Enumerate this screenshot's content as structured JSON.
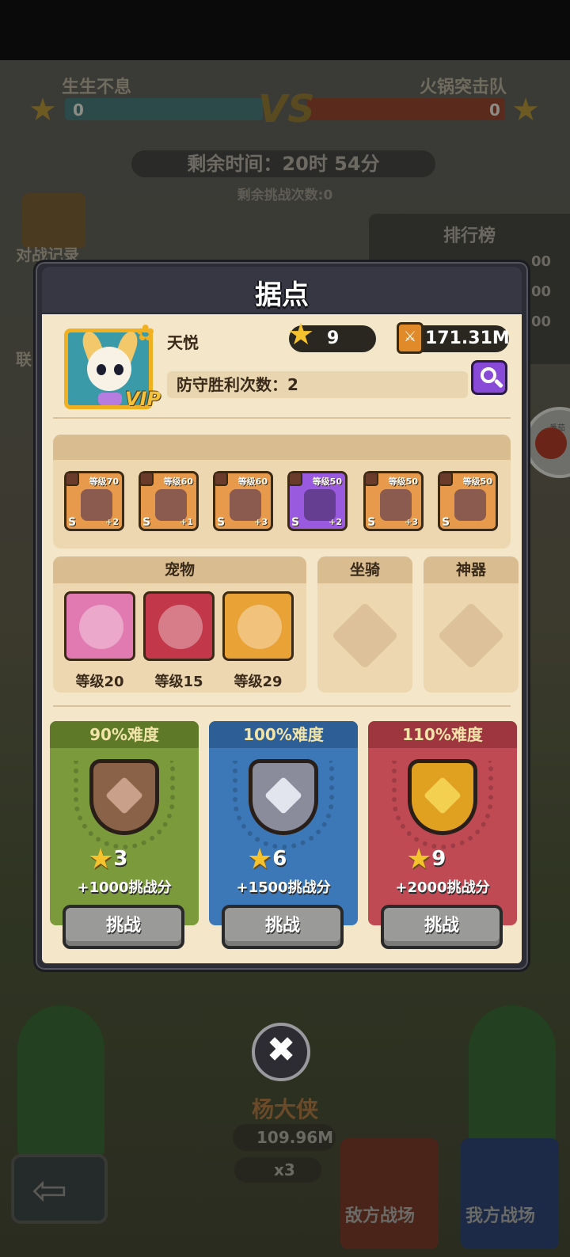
{
  "background": {
    "team_left": "生生不息",
    "team_right": "火锅突击队",
    "vs": "VS",
    "score_left": "0",
    "score_right": "0",
    "time_remaining": "剩余时间：20时 54分",
    "challenges_remaining": "剩余挑战次数:0",
    "leaderboard_title": "排行榜",
    "leaderboard_values": [
      "00",
      "00",
      "00"
    ],
    "side_buttons": [
      "对战记录",
      "联"
    ],
    "round_button_text": "番茄",
    "bottom_player_name": "杨大侠",
    "bottom_power": "109.96M",
    "bottom_stars": "x3",
    "enemy_field": "敌方战场",
    "my_field": "我方战场"
  },
  "modal": {
    "title": "据点",
    "player": {
      "name": "天悦",
      "vip": "VIP",
      "stars": "9",
      "power": "171.31M",
      "defense_label": "防守胜利次数：",
      "defense_wins": "2"
    },
    "equipment": [
      {
        "level": "等级70",
        "grade": "S",
        "plus": "+2",
        "rarity": "orange",
        "icon": "crossbow-icon"
      },
      {
        "level": "等级60",
        "grade": "S",
        "plus": "+1",
        "rarity": "orange",
        "icon": "cape-icon"
      },
      {
        "level": "等级60",
        "grade": "S",
        "plus": "+3",
        "rarity": "orange",
        "icon": "ring-icon"
      },
      {
        "level": "等级50",
        "grade": "S",
        "plus": "+2",
        "rarity": "purple",
        "icon": "bracer-icon"
      },
      {
        "level": "等级50",
        "grade": "S",
        "plus": "+3",
        "rarity": "orange",
        "icon": "orb-icon"
      },
      {
        "level": "等级50",
        "grade": "S",
        "plus": "",
        "rarity": "orange",
        "icon": "chalice-icon"
      }
    ],
    "pets_title": "宠物",
    "pets": [
      {
        "level": "等级20",
        "color": "#e07ab0",
        "icon": "mouse-pet-icon"
      },
      {
        "level": "等级15",
        "color": "#c2384a",
        "icon": "storm-cloud-pet-icon"
      },
      {
        "level": "等级29",
        "color": "#e8a236",
        "icon": "elephant-pet-icon"
      }
    ],
    "mount_title": "坐骑",
    "artifact_title": "神器",
    "challenges": [
      {
        "difficulty": "90%难度",
        "stars": "3",
        "score": "+1000挑战分",
        "button": "挑战",
        "bg": "#7a9a3c",
        "head": "#5e7a28",
        "shield": "#8a6248",
        "gem": "#c9a08a"
      },
      {
        "difficulty": "100%难度",
        "stars": "6",
        "score": "+1500挑战分",
        "button": "挑战",
        "bg": "#3c78b8",
        "head": "#2d5f96",
        "shield": "#8a8c9c",
        "gem": "#e2e4ee"
      },
      {
        "difficulty": "110%难度",
        "stars": "9",
        "score": "+2000挑战分",
        "button": "挑战",
        "bg": "#c04a54",
        "head": "#9e3640",
        "shield": "#e0a020",
        "gem": "#f4d050"
      }
    ],
    "close_symbol": "✖"
  }
}
